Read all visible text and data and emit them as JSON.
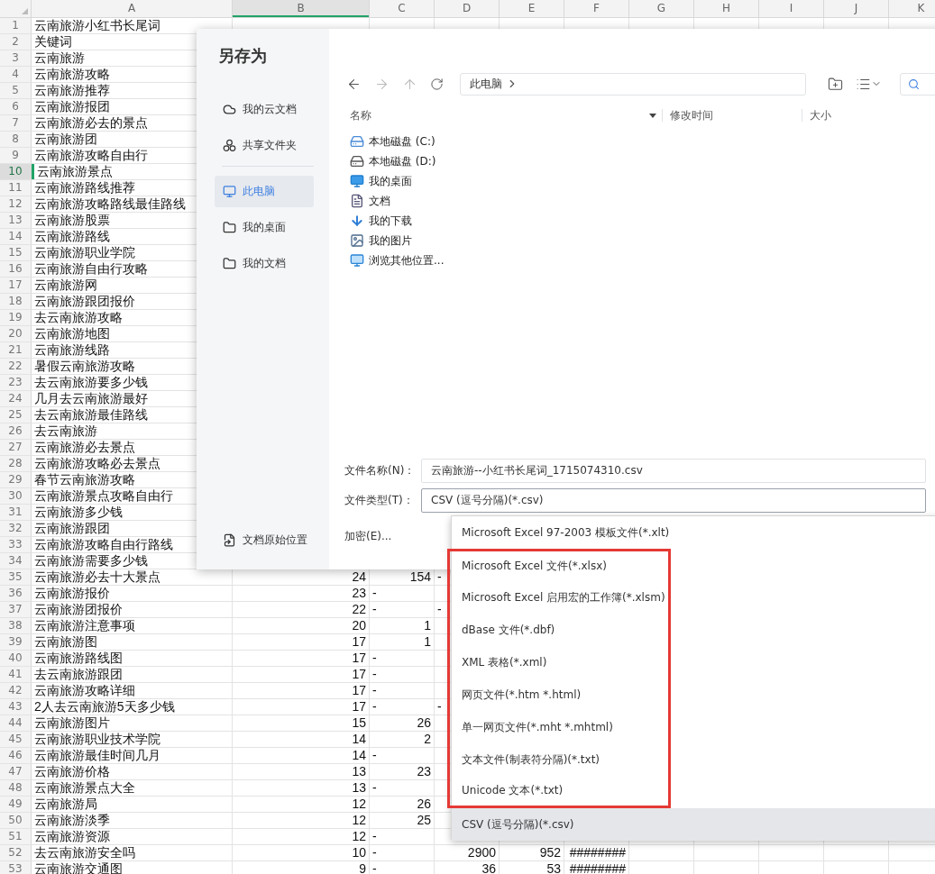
{
  "spreadsheet": {
    "columns": [
      {
        "label": "A",
        "selected": false
      },
      {
        "label": "B",
        "selected": true
      },
      {
        "label": "C",
        "selected": false
      },
      {
        "label": "D",
        "selected": false
      },
      {
        "label": "E",
        "selected": false
      },
      {
        "label": "F",
        "selected": false
      },
      {
        "label": "G",
        "selected": false
      },
      {
        "label": "H",
        "selected": false
      },
      {
        "label": "I",
        "selected": false
      },
      {
        "label": "J",
        "selected": false
      },
      {
        "label": "K",
        "selected": false
      }
    ],
    "rows": [
      {
        "number": "1",
        "selected": false,
        "keyword": "云南旅游小红书长尾词"
      },
      {
        "number": "2",
        "selected": false,
        "keyword": "关键词"
      },
      {
        "number": "3",
        "selected": false,
        "keyword": "云南旅游"
      },
      {
        "number": "4",
        "selected": false,
        "keyword": "云南旅游攻略"
      },
      {
        "number": "5",
        "selected": false,
        "keyword": "云南旅游推荐"
      },
      {
        "number": "6",
        "selected": false,
        "keyword": "云南旅游报团"
      },
      {
        "number": "7",
        "selected": false,
        "keyword": "云南旅游必去的景点"
      },
      {
        "number": "8",
        "selected": false,
        "keyword": "云南旅游团"
      },
      {
        "number": "9",
        "selected": false,
        "keyword": "云南旅游攻略自由行"
      },
      {
        "number": "10",
        "selected": true,
        "keyword": "云南旅游景点"
      },
      {
        "number": "11",
        "selected": false,
        "keyword": "云南旅游路线推荐"
      },
      {
        "number": "12",
        "selected": false,
        "keyword": "云南旅游攻略路线最佳路线"
      },
      {
        "number": "13",
        "selected": false,
        "keyword": "云南旅游股票"
      },
      {
        "number": "14",
        "selected": false,
        "keyword": "云南旅游路线"
      },
      {
        "number": "15",
        "selected": false,
        "keyword": "云南旅游职业学院"
      },
      {
        "number": "16",
        "selected": false,
        "keyword": "云南旅游自由行攻略"
      },
      {
        "number": "17",
        "selected": false,
        "keyword": "云南旅游网"
      },
      {
        "number": "18",
        "selected": false,
        "keyword": "云南旅游跟团报价"
      },
      {
        "number": "19",
        "selected": false,
        "keyword": "去云南旅游攻略"
      },
      {
        "number": "20",
        "selected": false,
        "keyword": "云南旅游地图"
      },
      {
        "number": "21",
        "selected": false,
        "keyword": "云南旅游线路"
      },
      {
        "number": "22",
        "selected": false,
        "keyword": "暑假云南旅游攻略"
      },
      {
        "number": "23",
        "selected": false,
        "keyword": "去云南旅游要多少钱"
      },
      {
        "number": "24",
        "selected": false,
        "keyword": "几月去云南旅游最好"
      },
      {
        "number": "25",
        "selected": false,
        "keyword": "去云南旅游最佳路线"
      },
      {
        "number": "26",
        "selected": false,
        "keyword": "去云南旅游"
      },
      {
        "number": "27",
        "selected": false,
        "keyword": "云南旅游必去景点"
      },
      {
        "number": "28",
        "selected": false,
        "keyword": "云南旅游攻略必去景点"
      },
      {
        "number": "29",
        "selected": false,
        "keyword": "春节云南旅游攻略"
      },
      {
        "number": "30",
        "selected": false,
        "keyword": "云南旅游景点攻略自由行"
      },
      {
        "number": "31",
        "selected": false,
        "keyword": "云南旅游多少钱"
      },
      {
        "number": "32",
        "selected": false,
        "keyword": "云南旅游跟团"
      },
      {
        "number": "33",
        "selected": false,
        "keyword": "云南旅游攻略自由行路线"
      },
      {
        "number": "34",
        "selected": false,
        "keyword": "云南旅游需要多少钱"
      },
      {
        "number": "35",
        "selected": false,
        "keyword": "云南旅游必去十大景点",
        "values": [
          {
            "text": "24",
            "kind": "number"
          },
          {
            "text": "154",
            "kind": "number"
          },
          {
            "text": "-",
            "kind": "text"
          }
        ]
      },
      {
        "number": "36",
        "selected": false,
        "keyword": "云南旅游报价",
        "values": [
          {
            "text": "23",
            "kind": "number"
          },
          {
            "text": "-",
            "kind": "text"
          }
        ]
      },
      {
        "number": "37",
        "selected": false,
        "keyword": "云南旅游团报价",
        "values": [
          {
            "text": "22",
            "kind": "number"
          },
          {
            "text": "-",
            "kind": "text"
          },
          {
            "text": "-",
            "kind": "text"
          }
        ]
      },
      {
        "number": "38",
        "selected": false,
        "keyword": "云南旅游注意事项",
        "values": [
          {
            "text": "20",
            "kind": "number"
          },
          {
            "text": "1",
            "kind": "number"
          }
        ]
      },
      {
        "number": "39",
        "selected": false,
        "keyword": "云南旅游图",
        "values": [
          {
            "text": "17",
            "kind": "number"
          },
          {
            "text": "1",
            "kind": "number"
          }
        ]
      },
      {
        "number": "40",
        "selected": false,
        "keyword": "云南旅游路线图",
        "values": [
          {
            "text": "17",
            "kind": "number"
          },
          {
            "text": "-",
            "kind": "text"
          }
        ]
      },
      {
        "number": "41",
        "selected": false,
        "keyword": "去云南旅游跟团",
        "values": [
          {
            "text": "17",
            "kind": "number"
          },
          {
            "text": "-",
            "kind": "text"
          }
        ]
      },
      {
        "number": "42",
        "selected": false,
        "keyword": "云南旅游攻略详细",
        "values": [
          {
            "text": "17",
            "kind": "number"
          },
          {
            "text": "-",
            "kind": "text"
          }
        ]
      },
      {
        "number": "43",
        "selected": false,
        "keyword": "2人去云南旅游5天多少钱",
        "values": [
          {
            "text": "17",
            "kind": "number"
          },
          {
            "text": "-",
            "kind": "text"
          },
          {
            "text": "-",
            "kind": "text"
          }
        ]
      },
      {
        "number": "44",
        "selected": false,
        "keyword": "云南旅游图片",
        "values": [
          {
            "text": "15",
            "kind": "number"
          },
          {
            "text": "26",
            "kind": "number"
          }
        ]
      },
      {
        "number": "45",
        "selected": false,
        "keyword": "云南旅游职业技术学院",
        "values": [
          {
            "text": "14",
            "kind": "number"
          },
          {
            "text": "2",
            "kind": "number"
          }
        ]
      },
      {
        "number": "46",
        "selected": false,
        "keyword": "云南旅游最佳时间几月",
        "values": [
          {
            "text": "14",
            "kind": "number"
          },
          {
            "text": "-",
            "kind": "text"
          }
        ]
      },
      {
        "number": "47",
        "selected": false,
        "keyword": "云南旅游价格",
        "values": [
          {
            "text": "13",
            "kind": "number"
          },
          {
            "text": "23",
            "kind": "number"
          }
        ]
      },
      {
        "number": "48",
        "selected": false,
        "keyword": "云南旅游景点大全",
        "values": [
          {
            "text": "13",
            "kind": "number"
          },
          {
            "text": "-",
            "kind": "text"
          }
        ]
      },
      {
        "number": "49",
        "selected": false,
        "keyword": "云南旅游局",
        "values": [
          {
            "text": "12",
            "kind": "number"
          },
          {
            "text": "26",
            "kind": "number"
          }
        ]
      },
      {
        "number": "50",
        "selected": false,
        "keyword": "云南旅游淡季",
        "values": [
          {
            "text": "12",
            "kind": "number"
          },
          {
            "text": "25",
            "kind": "number"
          }
        ]
      },
      {
        "number": "51",
        "selected": false,
        "keyword": "云南旅游资源",
        "values": [
          {
            "text": "12",
            "kind": "number"
          },
          {
            "text": "-",
            "kind": "text"
          }
        ]
      },
      {
        "number": "52",
        "selected": false,
        "keyword": "去云南旅游安全吗",
        "values": [
          {
            "text": "10",
            "kind": "number"
          },
          {
            "text": "-",
            "kind": "text"
          },
          {
            "text": "2900",
            "kind": "number"
          },
          {
            "text": "952",
            "kind": "number"
          },
          {
            "text": "########",
            "kind": "number"
          }
        ]
      },
      {
        "number": "53",
        "selected": false,
        "keyword": "云南旅游交通图",
        "values": [
          {
            "text": "9",
            "kind": "number"
          },
          {
            "text": "-",
            "kind": "text"
          },
          {
            "text": "36",
            "kind": "number"
          },
          {
            "text": "53",
            "kind": "number"
          },
          {
            "text": "########",
            "kind": "number"
          }
        ]
      }
    ]
  },
  "dialog": {
    "title": "另存为",
    "sidebar": [
      {
        "label": "我的云文档",
        "kind": "cloud",
        "selected": false
      },
      {
        "label": "共享文件夹",
        "kind": "share",
        "selected": false
      },
      {
        "label": "此电脑",
        "kind": "computer",
        "selected": true
      },
      {
        "label": "我的桌面",
        "kind": "folder",
        "selected": false
      },
      {
        "label": "我的文档",
        "kind": "folder",
        "selected": false
      }
    ],
    "sidebar_footer": "文档原始位置",
    "path": "此电脑",
    "list_columns": [
      "名称",
      "修改时间",
      "大小"
    ],
    "items": [
      {
        "name": "本地磁盘 (C:)",
        "kind": "system-drive"
      },
      {
        "name": "本地磁盘 (D:)",
        "kind": "drive"
      },
      {
        "name": "我的桌面",
        "kind": "desktop"
      },
      {
        "name": "文档",
        "kind": "document"
      },
      {
        "name": "我的下载",
        "kind": "download"
      },
      {
        "name": "我的图片",
        "kind": "picture"
      },
      {
        "name": "浏览其他位置...",
        "kind": "computer"
      }
    ],
    "filename_label": "文件名称(N)：",
    "filename": "云南旅游--小红书长尾词_1715074310.csv",
    "filetype_label": "文件类型(T)：",
    "filetype": "CSV (逗号分隔)(*.csv)",
    "encrypt": "加密(E)...",
    "options": [
      {
        "label": "Microsoft Excel 97-2003 模板文件(*.xlt)",
        "selected": false,
        "highlighted": false
      },
      {
        "label": "Microsoft Excel 文件(*.xlsx)",
        "selected": false,
        "highlighted": true
      },
      {
        "label": "Microsoft Excel 启用宏的工作簿(*.xlsm)",
        "selected": false,
        "highlighted": true
      },
      {
        "label": "dBase 文件(*.dbf)",
        "selected": false,
        "highlighted": true
      },
      {
        "label": "XML 表格(*.xml)",
        "selected": false,
        "highlighted": true
      },
      {
        "label": "网页文件(*.htm *.html)",
        "selected": false,
        "highlighted": true
      },
      {
        "label": "单一网页文件(*.mht *.mhtml)",
        "selected": false,
        "highlighted": true
      },
      {
        "label": "文本文件(制表符分隔)(*.txt)",
        "selected": false,
        "highlighted": true
      },
      {
        "label": "Unicode 文本(*.txt)",
        "selected": false,
        "highlighted": true
      },
      {
        "label": "CSV (逗号分隔)(*.csv)",
        "selected": true,
        "highlighted": false
      }
    ]
  }
}
